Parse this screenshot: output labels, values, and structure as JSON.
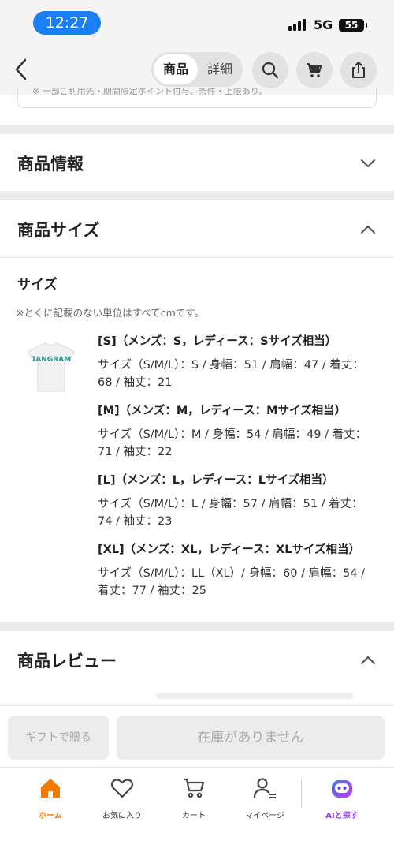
{
  "status": {
    "time": "12:27",
    "network": "5G",
    "battery": "55"
  },
  "nav": {
    "tab_active": "商品",
    "tab_inactive": "詳細"
  },
  "prev_note": "※ 一部ご利用先・期間限定ポイント付与。条件・上限あり。",
  "sections": {
    "info_title": "商品情報",
    "size_title": "商品サイズ",
    "review_title": "商品レビュー"
  },
  "size": {
    "heading": "サイズ",
    "note": "※とくに記載のない単位はすべてcmです。",
    "thumb_text": "TANGRAM",
    "items": [
      {
        "header": "[S]（メンズ：S，レディース：Sサイズ相当）",
        "detail": "サイズ（S/M/L）：S / 身幅：51 / 肩幅：47 / 着丈：68 / 袖丈：21"
      },
      {
        "header": "[M]（メンズ：M，レディース：Mサイズ相当）",
        "detail": "サイズ（S/M/L）：M / 身幅：54 / 肩幅：49 / 着丈：71 / 袖丈：22"
      },
      {
        "header": "[L]（メンズ：L，レディース：Lサイズ相当）",
        "detail": "サイズ（S/M/L）：L / 身幅：57 / 肩幅：51 / 着丈：74 / 袖丈：23"
      },
      {
        "header": "[XL]（メンズ：XL，レディース：XLサイズ相当）",
        "detail": "サイズ（S/M/L）：LL（XL）/ 身幅：60 / 肩幅：54 / 着丈：77 / 袖丈：25"
      }
    ]
  },
  "actions": {
    "gift": "ギフトで贈る",
    "stock": "在庫がありません"
  },
  "tabs": [
    {
      "label": "ホーム",
      "icon": "home-icon"
    },
    {
      "label": "お気に入り",
      "icon": "heart-icon"
    },
    {
      "label": "カート",
      "icon": "cart-icon"
    },
    {
      "label": "マイページ",
      "icon": "user-icon"
    },
    {
      "label": "AIと探す",
      "icon": "ai-icon"
    }
  ],
  "colors": {
    "accent": "#f27a00",
    "status_pill": "#1a7ff2",
    "ai": "#8a3cf0"
  }
}
